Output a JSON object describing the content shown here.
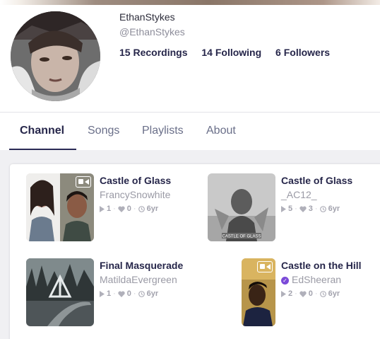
{
  "profile": {
    "username": "EthanStykes",
    "handle": "@EthanStykes",
    "stats": {
      "recordings": "15 Recordings",
      "following": "14 Following",
      "followers": "6 Followers"
    }
  },
  "tabs": [
    "Channel",
    "Songs",
    "Playlists",
    "About"
  ],
  "active_tab": "Channel",
  "recordings": [
    {
      "title": "Castle of Glass",
      "artist": "FrancySnowhite",
      "plays": "1",
      "likes": "0",
      "age": "6yr",
      "video": true,
      "verified": false
    },
    {
      "title": "Castle of Glass",
      "artist": "_AC12_",
      "plays": "5",
      "likes": "3",
      "age": "6yr",
      "video": false,
      "verified": false,
      "album_label": "CASTLE OF GLASS"
    },
    {
      "title": "Final Masquerade",
      "artist": "MatildaEvergreen",
      "plays": "1",
      "likes": "0",
      "age": "6yr",
      "video": false,
      "verified": false
    },
    {
      "title": "Castle on the Hill",
      "artist": "EdSheeran",
      "plays": "2",
      "likes": "0",
      "age": "6yr",
      "video": true,
      "verified": true
    }
  ],
  "colors": {
    "heading": "#26264a",
    "muted": "#9a9aa5",
    "accent_underline": "#2b2b55",
    "verified": "#7b4ad8"
  },
  "icons": [
    "play-icon",
    "heart-icon",
    "clock-icon",
    "video-camera-icon",
    "verified-check-icon"
  ]
}
